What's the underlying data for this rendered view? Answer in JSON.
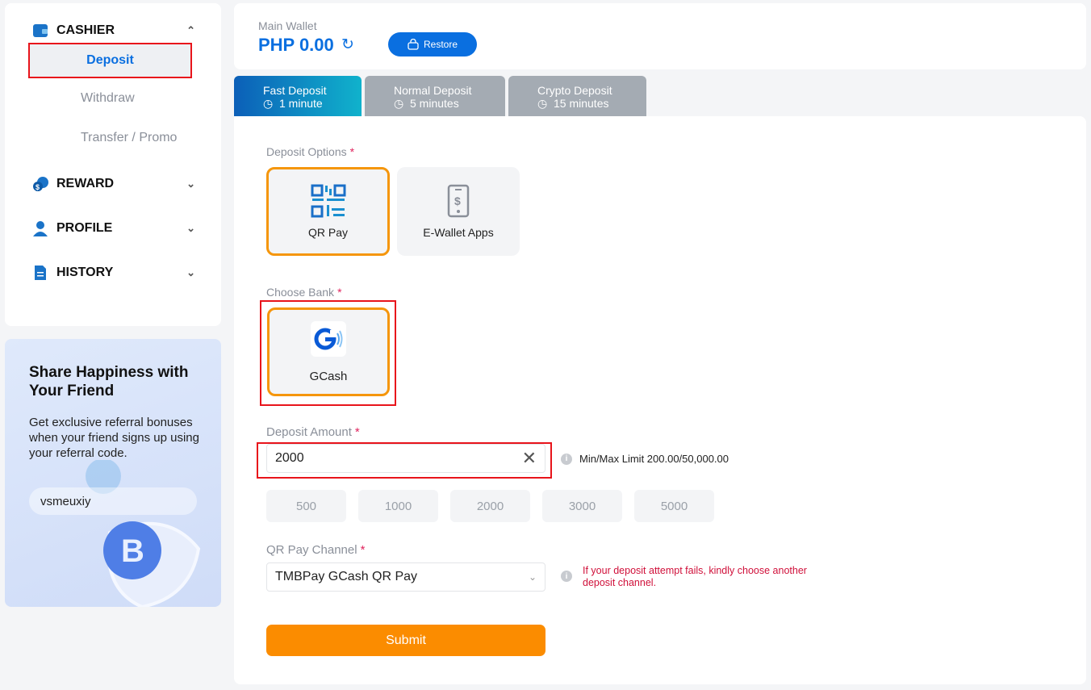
{
  "sidebar": {
    "cashier": {
      "label": "CASHIER",
      "icon": "wallet-icon",
      "expanded": true,
      "items": [
        {
          "label": "Deposit",
          "active": true
        },
        {
          "label": "Withdraw"
        },
        {
          "label": "Transfer / Promo"
        }
      ]
    },
    "sections": [
      {
        "label": "REWARD",
        "icon": "coins-icon"
      },
      {
        "label": "PROFILE",
        "icon": "user-icon"
      },
      {
        "label": "HISTORY",
        "icon": "document-icon"
      }
    ]
  },
  "promo": {
    "title": "Share Happiness with Your Friend",
    "text": "Get exclusive referral bonuses when your friend signs up using your referral code.",
    "code": "vsmeuxiy"
  },
  "wallet": {
    "label": "Main Wallet",
    "balance": "PHP 0.00",
    "restore_label": "Restore"
  },
  "tabs": [
    {
      "label": "Fast Deposit",
      "time": "1 minute",
      "active": true
    },
    {
      "label": "Normal Deposit",
      "time": "5 minutes"
    },
    {
      "label": "Crypto Deposit",
      "time": "15 minutes"
    }
  ],
  "form": {
    "deposit_options_label": "Deposit Options",
    "required": "*",
    "options": [
      {
        "label": "QR Pay",
        "icon": "qr-code-icon",
        "selected": true
      },
      {
        "label": "E-Wallet Apps",
        "icon": "phone-dollar-icon"
      }
    ],
    "choose_bank_label": "Choose Bank",
    "banks": [
      {
        "label": "GCash",
        "icon": "gcash-logo",
        "selected": true
      }
    ],
    "amount_label": "Deposit Amount",
    "amount_value": "2000",
    "limit_text": "Min/Max Limit 200.00/50,000.00",
    "quick_amounts": [
      "500",
      "1000",
      "2000",
      "3000",
      "5000"
    ],
    "channel_label": "QR Pay Channel",
    "channel_value": "TMBPay GCash QR Pay",
    "channel_warning": "If your deposit attempt fails, kindly choose another deposit channel.",
    "submit_label": "Submit"
  },
  "colors": {
    "accent": "#0a6fe0",
    "submit": "#fb8c00",
    "selected_border": "#f5960c",
    "warning": "#d0103a",
    "highlight_box": "#e8141b"
  }
}
